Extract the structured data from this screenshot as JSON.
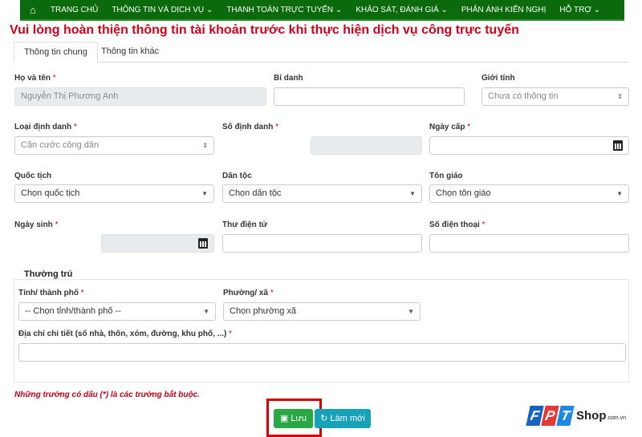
{
  "nav": {
    "items": [
      "TRANG CHỦ",
      "THÔNG TIN VÀ DỊCH VỤ",
      "THANH TOÁN TRỰC TUYẾN",
      "KHẢO SÁT, ĐÁNH GIÁ",
      "PHẢN ÁNH KIẾN NGHỊ",
      "HỖ TRỢ"
    ]
  },
  "title": "Vui lòng hoàn thiện thông tin tài khoản trước khi thực hiện dịch vụ công trực tuyến",
  "tabs": [
    "Thông tin chung",
    "Thông tin khác"
  ],
  "fields": {
    "ho_ten": {
      "label": "Họ và tên",
      "value": "Nguyễn Thị Phương Anh"
    },
    "bi_danh": {
      "label": "Bí danh",
      "value": ""
    },
    "gioi_tinh": {
      "label": "Giới tính",
      "value": "Chưa có thông tin"
    },
    "loai_dinh_danh": {
      "label": "Loại định danh",
      "value": "Căn cước công dân"
    },
    "so_dinh_danh": {
      "label": "Số định danh",
      "value": ""
    },
    "ngay_cap": {
      "label": "Ngày cấp",
      "value": ""
    },
    "quoc_tich": {
      "label": "Quốc tịch",
      "value": "Chọn quốc tịch"
    },
    "dan_toc": {
      "label": "Dân tộc",
      "value": "Chọn dân tộc"
    },
    "ton_giao": {
      "label": "Tôn giáo",
      "value": "Chọn tôn giáo"
    },
    "ngay_sinh": {
      "label": "Ngày sinh",
      "value": ""
    },
    "email": {
      "label": "Thư điện tử",
      "value": ""
    },
    "sdt": {
      "label": "Số điện thoại",
      "value": ""
    }
  },
  "thuong_tru": {
    "legend": "Thường trú",
    "tinh": {
      "label": "Tỉnh/ thành phố",
      "value": "-- Chọn tỉnh/thành phố --"
    },
    "phuong": {
      "label": "Phường/ xã",
      "value": "Chọn phường xã"
    },
    "dia_chi": {
      "label": "Địa chỉ chi tiết (số nhà, thôn, xóm, đường, khu phố, ...)",
      "value": ""
    }
  },
  "required_mark": "*",
  "note": "Những trường có dấu (*) là các trường bắt buộc.",
  "buttons": {
    "save": "Lưu",
    "reset": "Làm mới"
  },
  "logo": {
    "letters": [
      "F",
      "P",
      "T"
    ],
    "text": "Shop",
    "suffix": ".com.vn"
  },
  "colors": {
    "nav": "#0b6a0b",
    "accent_red": "#d0021b",
    "save": "#28a745",
    "reset": "#17a2b8"
  }
}
